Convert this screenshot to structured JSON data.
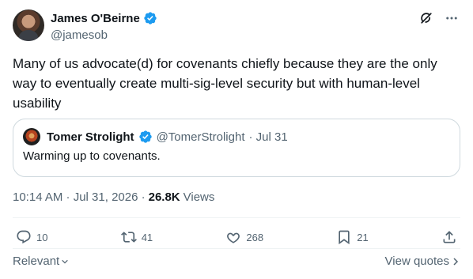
{
  "author": {
    "name": "James O'Beirne",
    "handle": "@jamesob"
  },
  "tweet": {
    "text": "Many of us advocate(d) for covenants chiefly because they are the only way to eventually create multi-sig-level security but with human-level usability"
  },
  "quote": {
    "name": "Tomer Strolight",
    "handle": "@TomerStrolight",
    "date": "· Jul 31",
    "text": "Warming up to covenants."
  },
  "meta": {
    "time": "10:14 AM · Jul 31, 2026 ·",
    "views_count": "26.8K",
    "views_label": "Views"
  },
  "actions": {
    "replies": "10",
    "reposts": "41",
    "likes": "268",
    "bookmarks": "21"
  },
  "footer": {
    "relevant": "Relevant",
    "view_quotes": "View quotes"
  },
  "colors": {
    "accent": "#1d9bf0",
    "text": "#0f1419",
    "muted": "#536471",
    "border": "#cfd9de"
  },
  "icons": [
    "verified-badge-icon",
    "grok-icon",
    "more-icon",
    "reply-icon",
    "repost-icon",
    "like-icon",
    "bookmark-icon",
    "share-icon",
    "chevron-down-icon",
    "chevron-right-icon"
  ]
}
